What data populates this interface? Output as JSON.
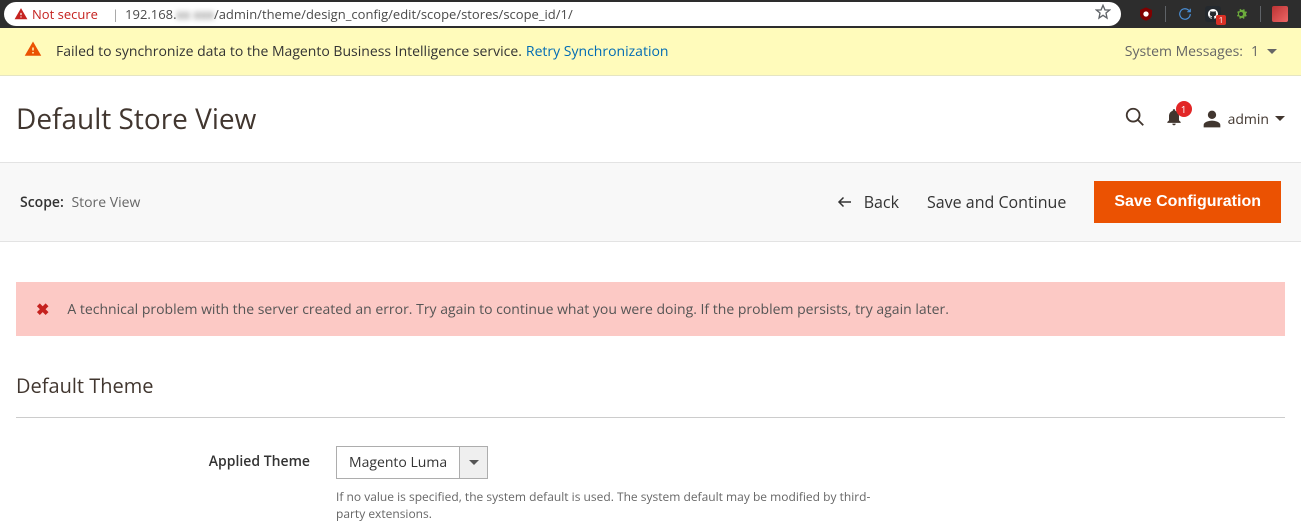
{
  "browser": {
    "not_secure": "Not secure",
    "url_prefix": "192.168.",
    "url_blur": "xx xxx",
    "url_path": "/admin/theme/design_config/edit/scope/stores/scope_id/1/"
  },
  "sys_msg": {
    "text": "Failed to synchronize data to the Magento Business Intelligence service.",
    "retry": "Retry Synchronization",
    "right_label": "System Messages:",
    "right_count": "1"
  },
  "header": {
    "title": "Default Store View",
    "notif_count": "1",
    "user": "admin"
  },
  "toolbar": {
    "scope_label": "Scope:",
    "scope_value": "Store View",
    "back": "Back",
    "save_continue": "Save and Continue",
    "save_config": "Save Configuration"
  },
  "error": {
    "text": "A technical problem with the server created an error. Try again to continue what you were doing. If the problem persists, try again later."
  },
  "section": {
    "title": "Default Theme",
    "field_label": "Applied Theme",
    "field_value": "Magento Luma",
    "field_note": "If no value is specified, the system default is used. The system default may be modified by third-party extensions."
  }
}
